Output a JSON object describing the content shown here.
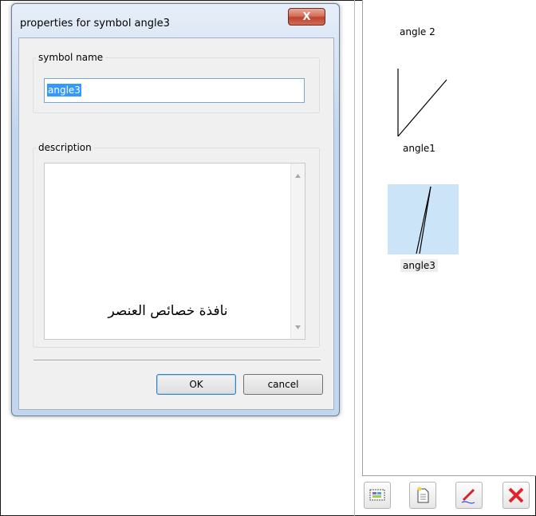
{
  "dialog": {
    "title": "properties for symbol angle3",
    "close_glyph": "X",
    "symbol_name_label": "symbol name",
    "symbol_name_value": "angle3",
    "description_label": "description",
    "description_text": "نافذة خصائص العنصر",
    "ok_label": "OK",
    "cancel_label": "cancel"
  },
  "symbols": [
    {
      "label": "angle 2",
      "selected": false
    },
    {
      "label": "angle1",
      "selected": false
    },
    {
      "label": "angle3",
      "selected": true
    }
  ],
  "toolbar": {
    "icons": [
      "select-region-icon",
      "new-document-icon",
      "edit-pencil-icon",
      "delete-x-icon"
    ]
  },
  "colors": {
    "selection_bg": "#cce4f7",
    "text_selection": "#3399ff",
    "close_button": "#c0432e"
  }
}
